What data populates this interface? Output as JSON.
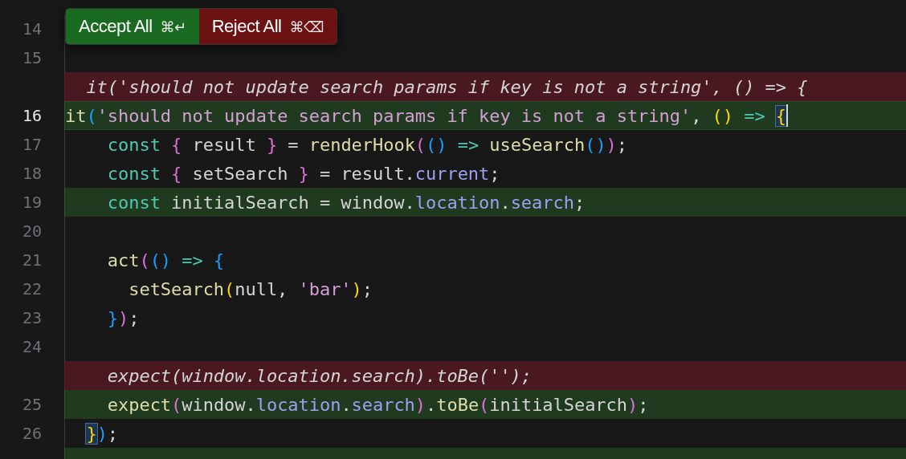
{
  "diff_toolbar": {
    "buttons": [
      {
        "kind": "accept",
        "label": "Accept All",
        "shortcut": "⌘↵"
      },
      {
        "kind": "reject",
        "label": "Reject All",
        "shortcut": "⌘⌫"
      }
    ]
  },
  "editor": {
    "lines": [
      {
        "kind": "context",
        "number": "14",
        "current": false
      },
      {
        "kind": "context",
        "number": "15",
        "current": false
      },
      {
        "kind": "deleted",
        "current": false,
        "tokens": [
          {
            "kind": "plain",
            "t": "  it('should not update search params if key is not a string', () => {"
          }
        ]
      },
      {
        "kind": "added",
        "number": "16",
        "current": true,
        "tokens": [
          {
            "kind": "func",
            "t": "it"
          },
          {
            "kind": "b3",
            "t": "("
          },
          {
            "kind": "string",
            "t": "'should not update search params if key is not a string'"
          },
          {
            "kind": "plain",
            "t": ", "
          },
          {
            "kind": "b1",
            "t": "()"
          },
          {
            "kind": "arrow",
            "t": " => "
          },
          {
            "kind": "b1",
            "t": "{",
            "match": true
          }
        ]
      },
      {
        "kind": "context",
        "number": "17",
        "current": false,
        "tokens": [
          {
            "kind": "keyword",
            "t": "    const "
          },
          {
            "kind": "b2",
            "t": "{"
          },
          {
            "kind": "plain",
            "t": " result "
          },
          {
            "kind": "b2",
            "t": "}"
          },
          {
            "kind": "plain",
            "t": " = "
          },
          {
            "kind": "func",
            "t": "renderHook"
          },
          {
            "kind": "b2",
            "t": "("
          },
          {
            "kind": "b3",
            "t": "()"
          },
          {
            "kind": "arrow",
            "t": " => "
          },
          {
            "kind": "func",
            "t": "useSearch"
          },
          {
            "kind": "b3",
            "t": "()"
          },
          {
            "kind": "b2",
            "t": ")"
          },
          {
            "kind": "plain",
            "t": ";"
          }
        ]
      },
      {
        "kind": "context",
        "number": "18",
        "current": false,
        "tokens": [
          {
            "kind": "keyword",
            "t": "    const "
          },
          {
            "kind": "b2",
            "t": "{"
          },
          {
            "kind": "plain",
            "t": " setSearch "
          },
          {
            "kind": "b2",
            "t": "}"
          },
          {
            "kind": "plain",
            "t": " = result."
          },
          {
            "kind": "prop",
            "t": "current"
          },
          {
            "kind": "plain",
            "t": ";"
          }
        ]
      },
      {
        "kind": "added",
        "number": "19",
        "current": false,
        "tokens": [
          {
            "kind": "keyword",
            "t": "    const "
          },
          {
            "kind": "plain",
            "t": "initialSearch = window."
          },
          {
            "kind": "prop",
            "t": "location"
          },
          {
            "kind": "plain",
            "t": "."
          },
          {
            "kind": "prop",
            "t": "search"
          },
          {
            "kind": "plain",
            "t": ";"
          }
        ]
      },
      {
        "kind": "context",
        "number": "20",
        "current": false
      },
      {
        "kind": "context",
        "number": "21",
        "current": false,
        "tokens": [
          {
            "kind": "func",
            "t": "    act"
          },
          {
            "kind": "b2",
            "t": "("
          },
          {
            "kind": "b3",
            "t": "()"
          },
          {
            "kind": "arrow",
            "t": " => "
          },
          {
            "kind": "b3",
            "t": "{"
          }
        ]
      },
      {
        "kind": "context",
        "number": "22",
        "current": false,
        "tokens": [
          {
            "kind": "func",
            "t": "      setSearch"
          },
          {
            "kind": "b1",
            "t": "("
          },
          {
            "kind": "plain",
            "t": "null, "
          },
          {
            "kind": "string",
            "t": "'bar'"
          },
          {
            "kind": "b1",
            "t": ")"
          },
          {
            "kind": "plain",
            "t": ";"
          }
        ]
      },
      {
        "kind": "context",
        "number": "23",
        "current": false,
        "tokens": [
          {
            "kind": "b3",
            "t": "    }"
          },
          {
            "kind": "b2",
            "t": ")"
          },
          {
            "kind": "plain",
            "t": ";"
          }
        ]
      },
      {
        "kind": "context",
        "number": "24",
        "current": false
      },
      {
        "kind": "deleted",
        "current": false,
        "tokens": [
          {
            "kind": "plain",
            "t": "    expect(window.location.search).toBe('');"
          }
        ]
      },
      {
        "kind": "added",
        "number": "25",
        "current": false,
        "tokens": [
          {
            "kind": "func",
            "t": "    expect"
          },
          {
            "kind": "b2",
            "t": "("
          },
          {
            "kind": "plain",
            "t": "window."
          },
          {
            "kind": "prop",
            "t": "location"
          },
          {
            "kind": "plain",
            "t": "."
          },
          {
            "kind": "prop",
            "t": "search"
          },
          {
            "kind": "b2",
            "t": ")"
          },
          {
            "kind": "plain",
            "t": "."
          },
          {
            "kind": "func",
            "t": "toBe"
          },
          {
            "kind": "b2",
            "t": "("
          },
          {
            "kind": "plain",
            "t": "initialSearch"
          },
          {
            "kind": "b2",
            "t": ")"
          },
          {
            "kind": "plain",
            "t": ";"
          }
        ]
      },
      {
        "kind": "context",
        "number": "26",
        "current": false,
        "tokens": [
          {
            "kind": "b1",
            "t": "  }",
            "match": true
          },
          {
            "kind": "b3",
            "t": ")"
          },
          {
            "kind": "plain",
            "t": ";"
          }
        ]
      },
      {
        "kind": "added",
        "current": false
      }
    ]
  }
}
